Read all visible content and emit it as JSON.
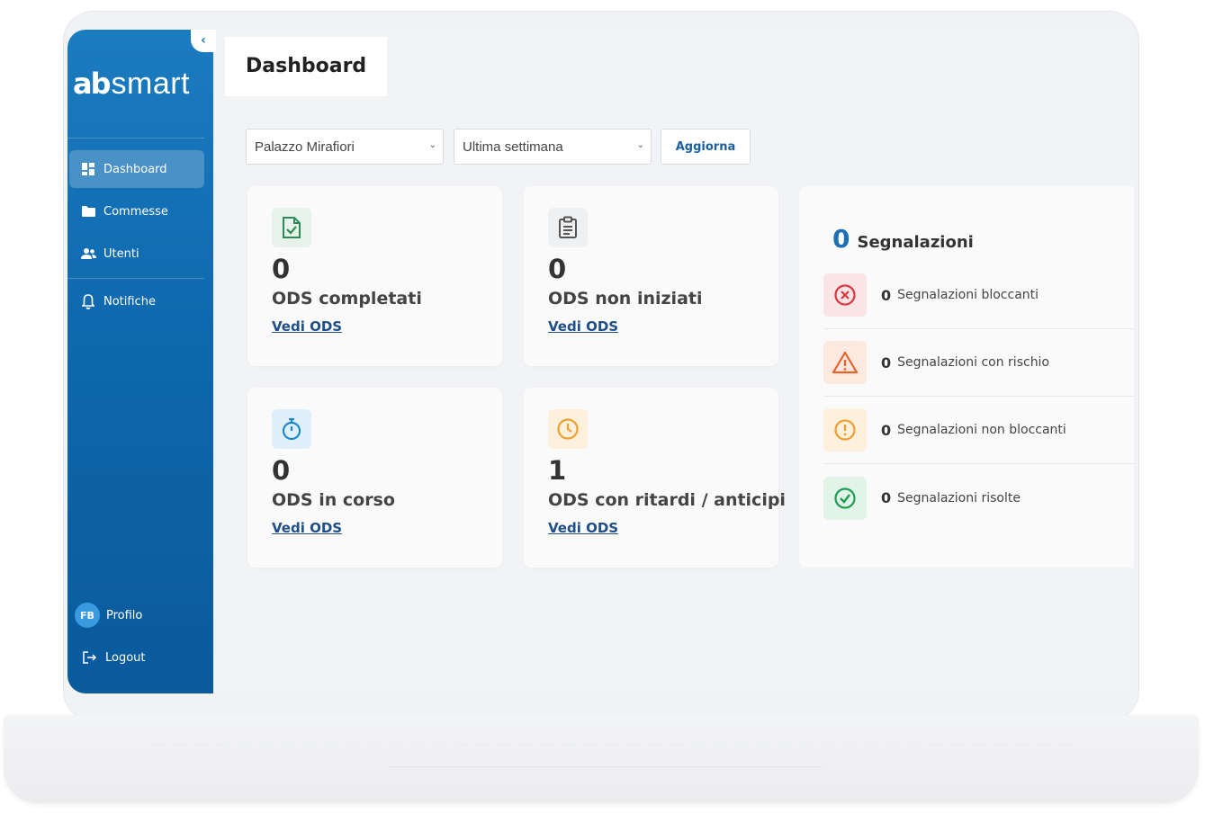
{
  "sidebar": {
    "logo_mark": "ab",
    "logo_text": "smart",
    "collapse_icon": "chevron-left-icon",
    "items": [
      {
        "label": "Dashboard",
        "icon": "dashboard-icon",
        "active": true
      },
      {
        "label": "Commesse",
        "icon": "folder-icon"
      },
      {
        "label": "Utenti",
        "icon": "users-icon"
      },
      {
        "label": "Notifiche",
        "icon": "bell-icon"
      }
    ],
    "profile": {
      "initials": "FB",
      "label": "Profilo"
    },
    "logout": {
      "label": "Logout",
      "icon": "logout-icon"
    }
  },
  "header": {
    "title": "Dashboard"
  },
  "filters": {
    "site": {
      "value": "Palazzo Mirafiori"
    },
    "period": {
      "value": "Ultima settimana"
    },
    "refresh_label": "Aggiorna"
  },
  "cards": [
    {
      "value": "0",
      "label": "ODS completati",
      "link": "Vedi ODS",
      "icon": "document-check-icon",
      "color": "#2e8b57"
    },
    {
      "value": "0",
      "label": "ODS non iniziati",
      "link": "Vedi ODS",
      "icon": "clipboard-icon",
      "color": "#555555"
    },
    {
      "value": "0",
      "label": "ODS in corso",
      "link": "Vedi ODS",
      "icon": "stopwatch-icon",
      "color": "#1e88c8"
    },
    {
      "value": "1",
      "label": "ODS con ritardi / anticipi",
      "link": "Vedi ODS",
      "icon": "clock-icon",
      "color": "#f0a030"
    }
  ],
  "segnalazioni": {
    "total": "0",
    "title": "Segnalazioni",
    "rows": [
      {
        "value": "0",
        "label": "Segnalazioni bloccanti",
        "icon": "x-circle-icon",
        "color": "#d9363e"
      },
      {
        "value": "0",
        "label": "Segnalazioni con rischio",
        "icon": "warning-triangle-icon",
        "color": "#e8632a"
      },
      {
        "value": "0",
        "label": "Segnalazioni non bloccanti",
        "icon": "exclamation-circle-icon",
        "color": "#f0a030"
      },
      {
        "value": "0",
        "label": "Segnalazioni risolte",
        "icon": "check-circle-icon",
        "color": "#1f9d55"
      }
    ]
  }
}
